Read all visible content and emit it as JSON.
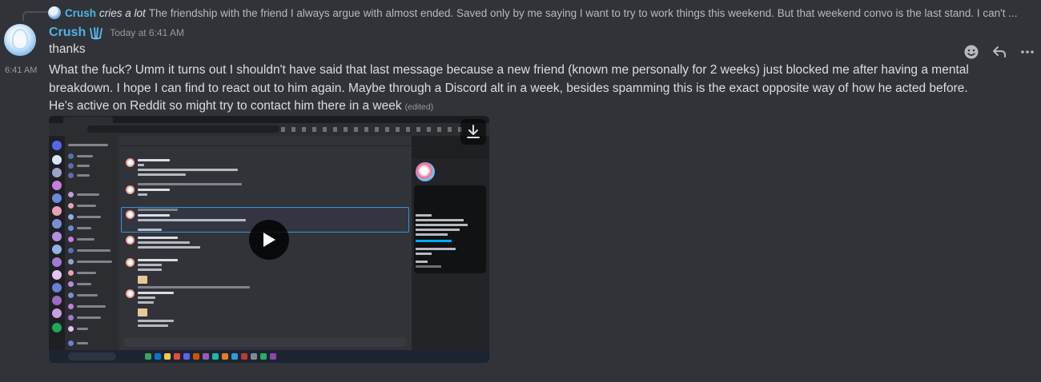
{
  "reply": {
    "author": "Crush",
    "action": "cries a lot",
    "text": "The friendship with the friend I always argue with almost ended. Saved only by me saying I want to try to work things this weekend. But that weekend convo is the last stand. I can't ..."
  },
  "message_group": {
    "author": "Crush",
    "author_color": "#4fb3e8",
    "timestamp": "Today at 6:41 AM",
    "first_line": "thanks"
  },
  "message": {
    "side_time": "6:41 AM",
    "text": "What the fuck? Umm it turns out I shouldn't have said that last message because a new friend (known me personally for 2 weeks) just blocked me after having a mental breakdown. I hope I can find to react out to him again. Maybe through a Discord alt in a week, besides spamming this is the exact opposite way of how he acted before. He's active on Reddit so might try to contact him there in a week",
    "edited_label": "(edited)"
  },
  "hover_toolbar": {
    "icons": [
      "add-reaction-icon",
      "reply-icon",
      "more-icon"
    ]
  },
  "attachment": {
    "type": "video",
    "icons": [
      "play-icon",
      "download-icon"
    ]
  },
  "colors": {
    "background": "#313338",
    "text": "#dbdee1",
    "muted": "#949ba4",
    "accent": "#4fb3e8"
  }
}
